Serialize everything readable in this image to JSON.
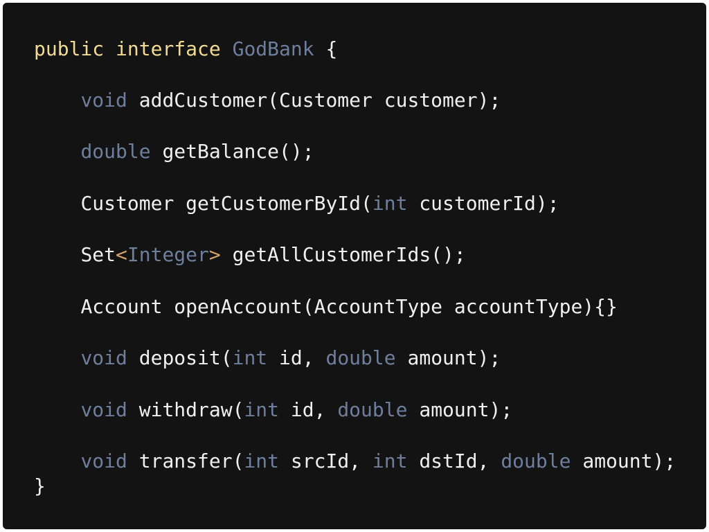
{
  "colors": {
    "background": "#131313",
    "frame": "#ffffff",
    "keyword": "#f2dc94",
    "type": "#6e7f9e",
    "operator": "#d3a36a",
    "text": "#f0f0f0"
  },
  "code": {
    "lines": [
      [
        {
          "text": "public",
          "kind": "kw"
        },
        {
          "text": " ",
          "kind": "plain"
        },
        {
          "text": "interface",
          "kind": "kw"
        },
        {
          "text": " ",
          "kind": "plain"
        },
        {
          "text": "GodBank",
          "kind": "type"
        },
        {
          "text": " {",
          "kind": "punct"
        }
      ],
      [
        {
          "text": "    ",
          "kind": "plain"
        },
        {
          "text": "void",
          "kind": "type"
        },
        {
          "text": " addCustomer(Customer customer);",
          "kind": "ident"
        }
      ],
      [
        {
          "text": "    ",
          "kind": "plain"
        },
        {
          "text": "double",
          "kind": "type"
        },
        {
          "text": " getBalance();",
          "kind": "ident"
        }
      ],
      [
        {
          "text": "    ",
          "kind": "plain"
        },
        {
          "text": "Customer getCustomerById(",
          "kind": "ident"
        },
        {
          "text": "int",
          "kind": "type"
        },
        {
          "text": " customerId);",
          "kind": "ident"
        }
      ],
      [
        {
          "text": "    ",
          "kind": "plain"
        },
        {
          "text": "Set",
          "kind": "ident"
        },
        {
          "text": "<",
          "kind": "op"
        },
        {
          "text": "Integer",
          "kind": "type"
        },
        {
          "text": ">",
          "kind": "op"
        },
        {
          "text": " getAllCustomerIds();",
          "kind": "ident"
        }
      ],
      [
        {
          "text": "    ",
          "kind": "plain"
        },
        {
          "text": "Account openAccount(AccountType accountType){}",
          "kind": "ident"
        }
      ],
      [
        {
          "text": "    ",
          "kind": "plain"
        },
        {
          "text": "void",
          "kind": "type"
        },
        {
          "text": " deposit(",
          "kind": "ident"
        },
        {
          "text": "int",
          "kind": "type"
        },
        {
          "text": " id, ",
          "kind": "ident"
        },
        {
          "text": "double",
          "kind": "type"
        },
        {
          "text": " amount);",
          "kind": "ident"
        }
      ],
      [
        {
          "text": "    ",
          "kind": "plain"
        },
        {
          "text": "void",
          "kind": "type"
        },
        {
          "text": " withdraw(",
          "kind": "ident"
        },
        {
          "text": "int",
          "kind": "type"
        },
        {
          "text": " id, ",
          "kind": "ident"
        },
        {
          "text": "double",
          "kind": "type"
        },
        {
          "text": " amount);",
          "kind": "ident"
        }
      ],
      [
        {
          "text": "    ",
          "kind": "plain"
        },
        {
          "text": "void",
          "kind": "type"
        },
        {
          "text": " transfer(",
          "kind": "ident"
        },
        {
          "text": "int",
          "kind": "type"
        },
        {
          "text": " srcId, ",
          "kind": "ident"
        },
        {
          "text": "int",
          "kind": "type"
        },
        {
          "text": " dstId, ",
          "kind": "ident"
        },
        {
          "text": "double",
          "kind": "type"
        },
        {
          "text": " amount);",
          "kind": "ident"
        }
      ],
      [
        {
          "text": "}",
          "kind": "punct"
        }
      ]
    ]
  }
}
